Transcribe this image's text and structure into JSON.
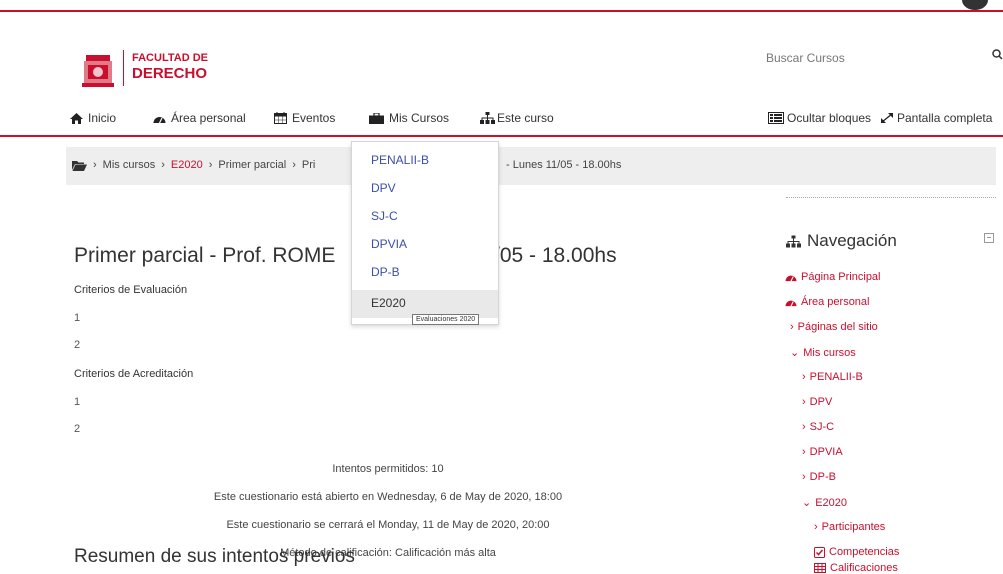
{
  "header": {
    "brand_line1": "FACULTAD DE",
    "brand_line2": "DERECHO",
    "search_placeholder": "Buscar Cursos"
  },
  "nav": {
    "inicio": "Inicio",
    "area_personal": "Área personal",
    "eventos": "Eventos",
    "mis_cursos": "Mis Cursos",
    "este_curso": "Este curso",
    "ocultar_bloques": "Ocultar bloques",
    "pantalla_completa": "Pantalla completa"
  },
  "breadcrumb": {
    "items": [
      "Mis cursos",
      "E2020",
      "Primer parcial",
      "Pri"
    ],
    "tail": "- Lunes 11/05 - 18.00hs"
  },
  "dropdown": {
    "items": [
      "PENALII-B",
      "DPV",
      "SJ-C",
      "DPVIA",
      "DP-B",
      "E2020"
    ],
    "tooltip": "Evaluaciones 2020"
  },
  "main": {
    "title_part1": "Primer parcial - Prof. ROME",
    "title_part2": "/05 - 18.00hs",
    "eval_label": "Criterios de Evaluación",
    "eval_items": [
      "1",
      "2"
    ],
    "acred_label": "Criterios de Acreditación",
    "acred_items": [
      "1",
      "2"
    ],
    "intentos": "Intentos permitidos: 10",
    "abierto": "Este cuestionario está abierto en Wednesday, 6 de May de 2020, 18:00",
    "cerrara": "Este cuestionario se cerrará el Monday, 11 de May de 2020, 20:00",
    "metodo": "Método de calificación: Calificación más alta",
    "resumen": "Resumen de sus intentos previos"
  },
  "navigation_block": {
    "title": "Navegación",
    "items": [
      "Página Principal",
      "Área personal",
      "Páginas del sitio",
      "Mis cursos",
      "PENALII-B",
      "DPV",
      "SJ-C",
      "DPVIA",
      "DP-B",
      "E2020",
      "Participantes",
      "Competencias",
      "Calificaciones"
    ]
  },
  "colors": {
    "brand_red": "#c8102e",
    "link_blue": "#3b4fa6"
  }
}
